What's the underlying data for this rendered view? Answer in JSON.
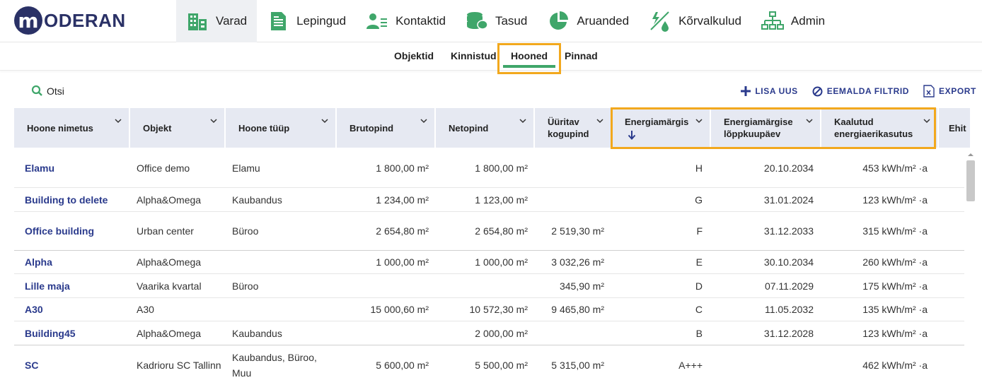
{
  "logo": {
    "mark": "m",
    "text": "ODERAN"
  },
  "nav": [
    {
      "label": "Varad",
      "icon": "building-icon",
      "active": true
    },
    {
      "label": "Lepingud",
      "icon": "document-icon"
    },
    {
      "label": "Kontaktid",
      "icon": "contacts-icon"
    },
    {
      "label": "Tasud",
      "icon": "coins-icon"
    },
    {
      "label": "Aruanded",
      "icon": "pie-chart-icon"
    },
    {
      "label": "Kõrvalkulud",
      "icon": "utilities-icon"
    },
    {
      "label": "Admin",
      "icon": "org-chart-icon"
    }
  ],
  "subnav": [
    "Objektid",
    "Kinnistud",
    "Hooned",
    "Pinnad"
  ],
  "toolbar": {
    "search_label": "Otsi",
    "add_label": "LISA UUS",
    "clear_label": "EEMALDA FILTRID",
    "export_label": "EXPORT"
  },
  "columns": [
    "Hoone nimetus",
    "Objekt",
    "Hoone tüüp",
    "Brutopind",
    "Netopind",
    "Üüritav kogupind",
    "Energiamärgis",
    "Energiamärgise lõppkuupäev",
    "Kaalutud energiaerikasutus",
    "Ehit"
  ],
  "rows": [
    {
      "name": "Elamu",
      "object": "Office demo",
      "type": "Elamu",
      "gross": "1 800,00 m²",
      "net": "1 800,00 m²",
      "rentable": "",
      "label": "H",
      "expiry": "20.10.2034",
      "energy": "453 kWh/m² ·a"
    },
    {
      "name": "Building to delete",
      "object": "Alpha&Omega",
      "type": "Kaubandus",
      "gross": "1 234,00 m²",
      "net": "1 123,00 m²",
      "rentable": "",
      "label": "G",
      "expiry": "31.01.2024",
      "energy": "123 kWh/m² ·a"
    },
    {
      "name": "Office building",
      "object": "Urban center",
      "type": "Büroo",
      "gross": "2 654,80 m²",
      "net": "2 654,80 m²",
      "rentable": "2 519,30 m²",
      "label": "F",
      "expiry": "31.12.2033",
      "energy": "315 kWh/m² ·a"
    },
    {
      "name": "Alpha",
      "object": "Alpha&Omega",
      "type": "",
      "gross": "1 000,00 m²",
      "net": "1 000,00 m²",
      "rentable": "3 032,26 m²",
      "label": "E",
      "expiry": "30.10.2034",
      "energy": "260 kWh/m² ·a"
    },
    {
      "name": "Lille maja",
      "object": "Vaarika kvartal",
      "type": "Büroo",
      "gross": "",
      "net": "",
      "rentable": "345,90 m²",
      "label": "D",
      "expiry": "07.11.2029",
      "energy": "175 kWh/m² ·a"
    },
    {
      "name": "A30",
      "object": "A30",
      "type": "",
      "gross": "15 000,60 m²",
      "net": "10 572,30 m²",
      "rentable": "9 465,80 m²",
      "label": "C",
      "expiry": "11.05.2032",
      "energy": "135 kWh/m² ·a"
    },
    {
      "name": "Building45",
      "object": "Alpha&Omega",
      "type": "Kaubandus",
      "gross": "",
      "net": "2 000,00 m²",
      "rentable": "",
      "label": "B",
      "expiry": "31.12.2028",
      "energy": "123 kWh/m² ·a"
    },
    {
      "name": "SC",
      "object": "Kadrioru SC Tallinn",
      "type": "Kaubandus, Büroo, Muu",
      "gross": "5 600,00 m²",
      "net": "5 500,00 m²",
      "rentable": "5 315,00 m²",
      "label": "A+++",
      "expiry": "",
      "energy": "462 kWh/m² ·a"
    }
  ],
  "colors": {
    "brand": "#2a3166",
    "link": "#2a3a8c",
    "accent_green": "#3fa66a",
    "highlight": "#f2a81d",
    "header_bg": "#e6e9f2"
  }
}
